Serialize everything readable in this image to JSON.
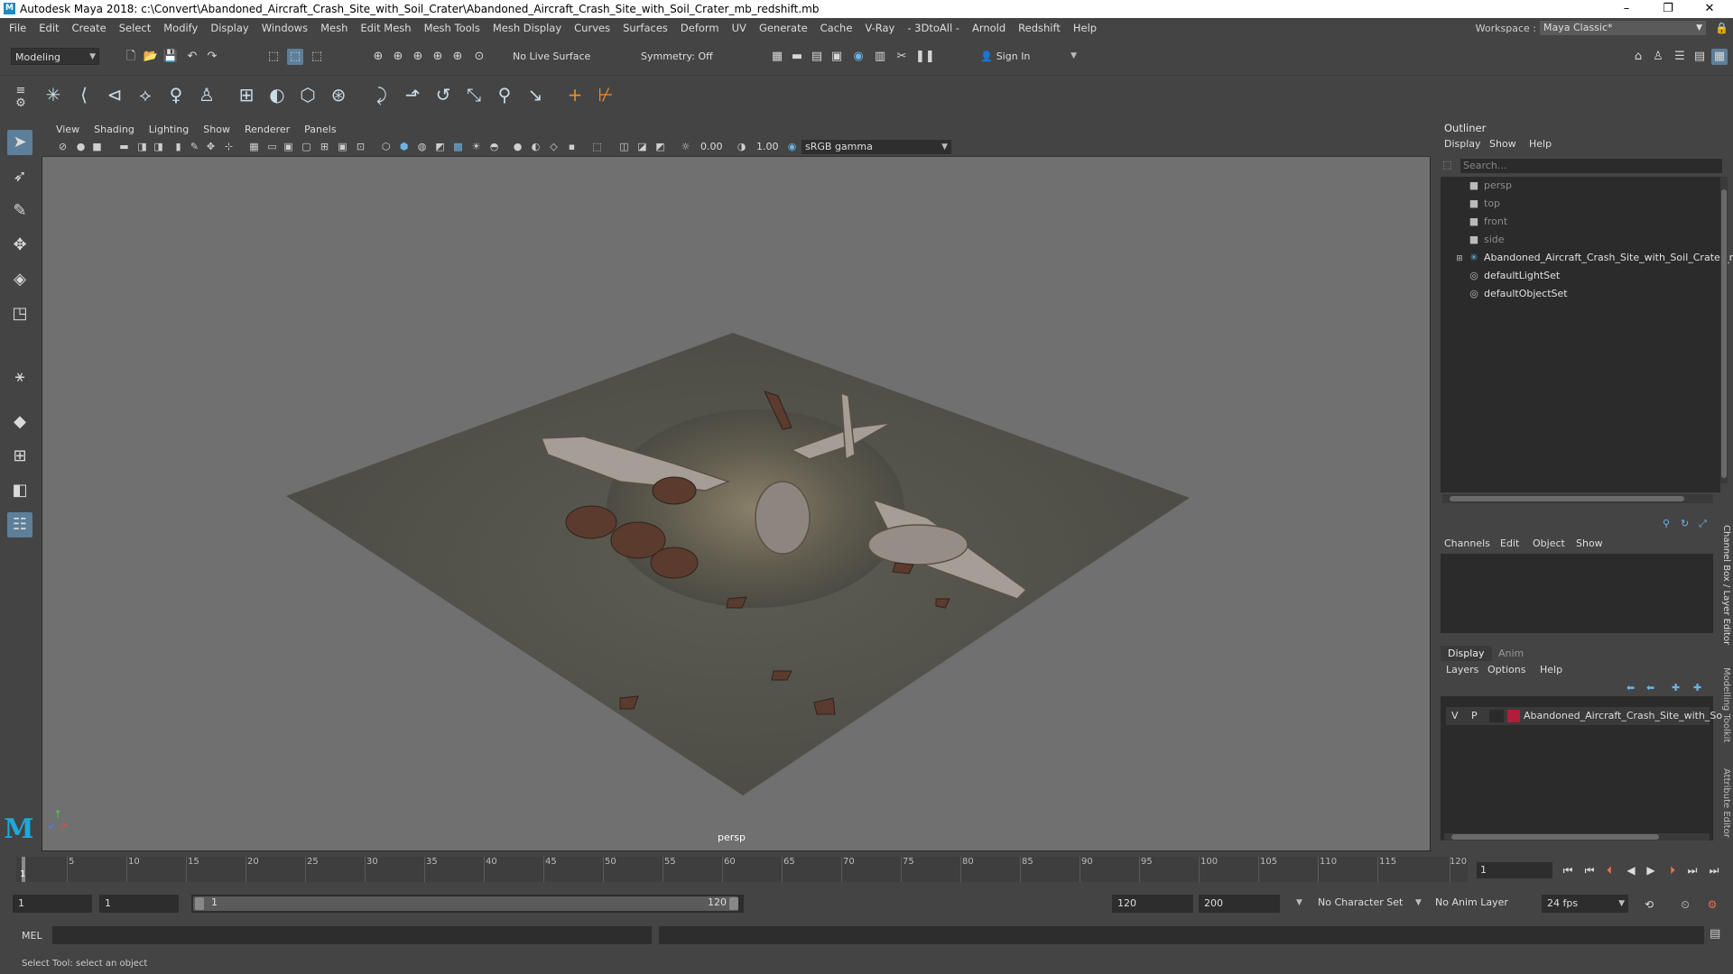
{
  "window": {
    "title": "Autodesk Maya 2018: c:\\Convert\\Abandoned_Aircraft_Crash_Site_with_Soil_Crater\\Abandoned_Aircraft_Crash_Site_with_Soil_Crater_mb_redshift.mb",
    "minimize": "–",
    "maximize": "❐",
    "close": "✕"
  },
  "menubar": {
    "items": [
      "File",
      "Edit",
      "Create",
      "Select",
      "Modify",
      "Display",
      "Windows",
      "Mesh",
      "Edit Mesh",
      "Mesh Tools",
      "Mesh Display",
      "Curves",
      "Surfaces",
      "Deform",
      "UV",
      "Generate",
      "Cache",
      "V-Ray",
      "- 3DtoAll -",
      "Arnold",
      "Redshift",
      "Help"
    ],
    "workspace_label": "Workspace :",
    "workspace_value": "Maya Classic*"
  },
  "statusline": {
    "mode": "Modeling",
    "live_surface": "No Live Surface",
    "symmetry": "Symmetry: Off",
    "sign_in": "Sign In"
  },
  "viewport": {
    "menus": [
      "View",
      "Shading",
      "Lighting",
      "Show",
      "Renderer",
      "Panels"
    ],
    "exposure": "0.00",
    "gamma": "1.00",
    "colorspace": "sRGB gamma",
    "camera": "persp"
  },
  "outliner": {
    "title": "Outliner",
    "menus": [
      "Display",
      "Show",
      "Help"
    ],
    "search_placeholder": "Search...",
    "items": [
      {
        "label": "persp",
        "icon": "camera-icon",
        "dim": true
      },
      {
        "label": "top",
        "icon": "camera-icon",
        "dim": true
      },
      {
        "label": "front",
        "icon": "camera-icon",
        "dim": true
      },
      {
        "label": "side",
        "icon": "camera-icon",
        "dim": true
      },
      {
        "label": "Abandoned_Aircraft_Crash_Site_with_Soil_Crater_r",
        "icon": "group-icon",
        "dim": false
      },
      {
        "label": "defaultLightSet",
        "icon": "set-icon",
        "dim": false
      },
      {
        "label": "defaultObjectSet",
        "icon": "set-icon",
        "dim": false
      }
    ]
  },
  "channelbox": {
    "menus": [
      "Channels",
      "Edit",
      "Object",
      "Show"
    ]
  },
  "layer_editor": {
    "tabs": [
      "Display",
      "Anim"
    ],
    "menus": [
      "Layers",
      "Options",
      "Help"
    ],
    "layer": {
      "v": "V",
      "p": "P",
      "name": "Abandoned_Aircraft_Crash_Site_with_So",
      "color": "#b01e3a"
    }
  },
  "side_tabs": [
    "Channel Box / Layer Editor",
    "Modelling Toolkit",
    "Attribute Editor"
  ],
  "timeline": {
    "ticks": [
      "5",
      "10",
      "15",
      "20",
      "25",
      "30",
      "35",
      "40",
      "45",
      "50",
      "55",
      "60",
      "65",
      "70",
      "75",
      "80",
      "85",
      "90",
      "95",
      "100",
      "105",
      "110",
      "115",
      "120"
    ],
    "start_label": "1",
    "current_frame": "1"
  },
  "range": {
    "start": "1",
    "playback_start": "1",
    "slider_start": "1",
    "slider_end": "120",
    "playback_end": "120",
    "end": "200",
    "character_set": "No Character Set",
    "anim_layer": "No Anim Layer",
    "fps": "24 fps"
  },
  "command": {
    "label": "MEL"
  },
  "help": {
    "text": "Select Tool: select an object"
  }
}
